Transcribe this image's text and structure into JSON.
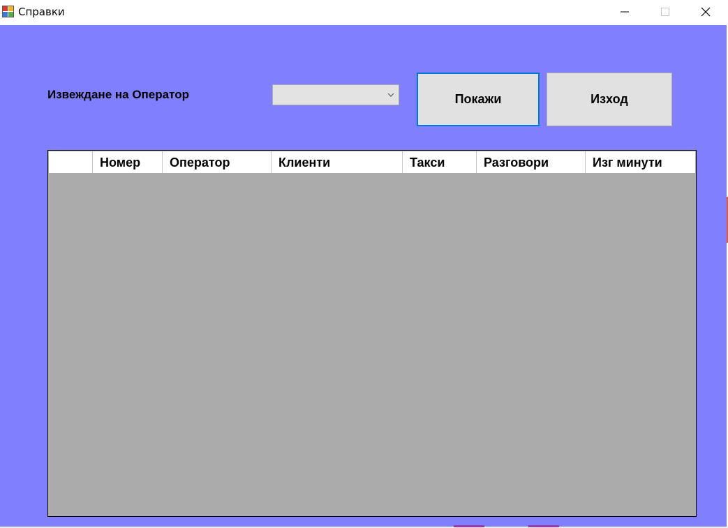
{
  "window": {
    "title": "Справки"
  },
  "form": {
    "operator_label": "Извеждане на Оператор",
    "operator_select_value": "",
    "show_button": "Покажи",
    "exit_button": "Изход"
  },
  "grid": {
    "columns": [
      "",
      "Номер",
      "Оператор",
      "Клиенти",
      "Такси",
      "Разговори",
      "Изг минути"
    ],
    "rows": []
  },
  "colors": {
    "form_background": "#8080ff",
    "grid_background": "#ababab",
    "button_face": "#e1e1e1",
    "focus_border": "#0078d7"
  }
}
